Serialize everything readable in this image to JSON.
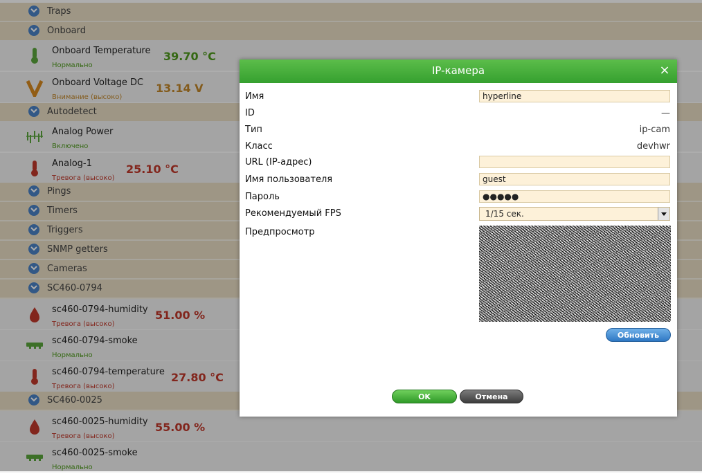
{
  "list": {
    "groups": {
      "traps": "Traps",
      "onboard": "Onboard",
      "autodetect": "Autodetect",
      "pings": "Pings",
      "timers": "Timers",
      "triggers": "Triggers",
      "snmp_getters": "SNMP getters",
      "cameras": "Cameras",
      "sc460_0794": "SC460-0794",
      "sc460_0025": "SC460-0025"
    },
    "sensors": {
      "onboard_temp": {
        "name": "Onboard Temperature",
        "status": "Нормально",
        "value": "39.70 °C"
      },
      "onboard_voltage": {
        "name": "Onboard Voltage DC",
        "status": "Внимание (высоко)",
        "value": "13.14 V"
      },
      "analog_power": {
        "name": "Analog Power",
        "status": "Включено",
        "value": ""
      },
      "analog_1": {
        "name": "Analog-1",
        "status": "Тревога (высоко)",
        "value": "25.10 °C"
      },
      "sc0794_humidity": {
        "name": "sc460-0794-humidity",
        "status": "Тревога (высоко)",
        "value": "51.00 %"
      },
      "sc0794_smoke": {
        "name": "sc460-0794-smoke",
        "status": "Нормально",
        "value": ""
      },
      "sc0794_temperature": {
        "name": "sc460-0794-temperature",
        "status": "Тревога (высоко)",
        "value": "27.80 °C"
      },
      "sc0025_humidity": {
        "name": "sc460-0025-humidity",
        "status": "Тревога (высоко)",
        "value": "55.00 %"
      },
      "sc0025_smoke": {
        "name": "sc460-0025-smoke",
        "status": "Нормально",
        "value": ""
      }
    }
  },
  "dialog": {
    "title": "IP-камера",
    "close_glyph": "×",
    "fields": {
      "name": {
        "label": "Имя",
        "value": "hyperline"
      },
      "id": {
        "label": "ID",
        "value": "—"
      },
      "type": {
        "label": "Тип",
        "value": "ip-cam"
      },
      "class": {
        "label": "Класс",
        "value": "devhwr"
      },
      "url": {
        "label": "URL (IP-адрес)",
        "value": ""
      },
      "username": {
        "label": "Имя пользователя",
        "value": "guest"
      },
      "password": {
        "label": "Пароль",
        "value": "●●●●●"
      },
      "fps": {
        "label": "Рекомендуемый FPS",
        "value": "1/15 сек."
      },
      "preview": {
        "label": "Предпросмотр"
      }
    },
    "refresh_label": "Обновить",
    "ok_label": "OK",
    "cancel_label": "Отмена"
  },
  "colors": {
    "header_green": "#35a02f",
    "group_row_bg": "#e9dec5",
    "input_bg": "#fdf1d9",
    "status_ok": "#4e9a1c",
    "status_warn": "#c2872a",
    "status_alarm": "#c0392b"
  }
}
